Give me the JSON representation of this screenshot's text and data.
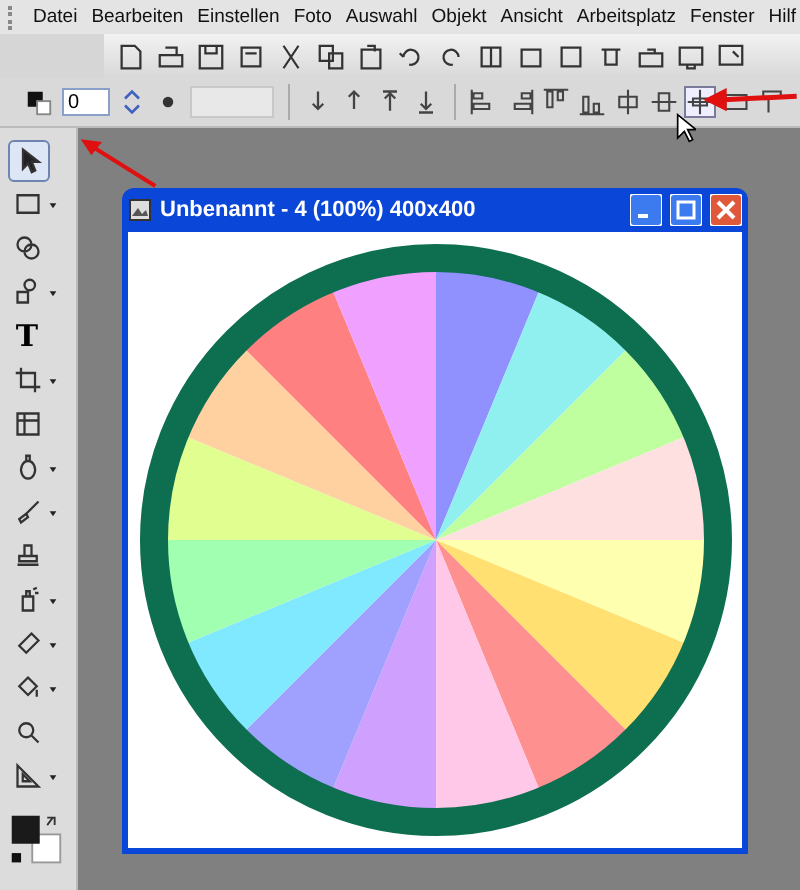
{
  "menu": [
    "Datei",
    "Bearbeiten",
    "Einstellen",
    "Foto",
    "Auswahl",
    "Objekt",
    "Ansicht",
    "Arbeitsplatz",
    "Fenster",
    "Hilf"
  ],
  "options_bar": {
    "size_field": {
      "value": "0"
    },
    "second_field": {
      "disabled": true
    }
  },
  "tools": [
    {
      "kind": "pointer",
      "selected": true,
      "has_menu": false
    },
    {
      "kind": "marquee",
      "selected": false,
      "has_menu": true
    },
    {
      "kind": "circles",
      "selected": false,
      "has_menu": false
    },
    {
      "kind": "shapes",
      "selected": false,
      "has_menu": true
    },
    {
      "kind": "text",
      "label": "T",
      "selected": false,
      "has_menu": false
    },
    {
      "kind": "crop",
      "selected": false,
      "has_menu": true
    },
    {
      "kind": "frame",
      "selected": false,
      "has_menu": false
    },
    {
      "kind": "bulb",
      "selected": false,
      "has_menu": true
    },
    {
      "kind": "brush",
      "selected": false,
      "has_menu": true
    },
    {
      "kind": "stamp",
      "selected": false,
      "has_menu": false
    },
    {
      "kind": "spray",
      "selected": false,
      "has_menu": true
    },
    {
      "kind": "eraser",
      "selected": false,
      "has_menu": true
    },
    {
      "kind": "bucket",
      "selected": false,
      "has_menu": true
    },
    {
      "kind": "zoom",
      "selected": false,
      "has_menu": false
    },
    {
      "kind": "triangle",
      "selected": false,
      "has_menu": true
    }
  ],
  "document_window": {
    "title": "Unbenannt - 4 (100%) 400x400",
    "kind": "picture"
  }
}
